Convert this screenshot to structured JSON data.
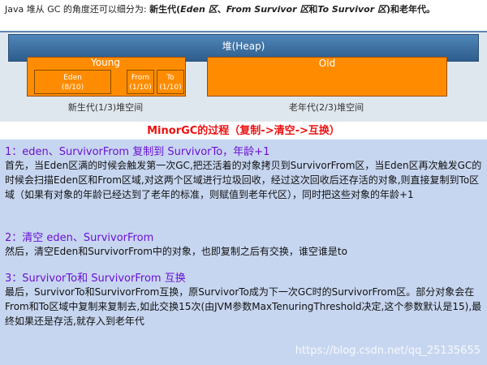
{
  "intro": {
    "prefix": "Java 堆从 GC 的角度还可以细分为: ",
    "new_gen": "新生代",
    "paren_open": "(",
    "eden": "Eden 区",
    "sep1": "、",
    "from": "From Survivor 区",
    "and": "和",
    "to": "To Survivor 区",
    "paren_close": ")",
    "and_old": "和老年代",
    "period": "。"
  },
  "diagram": {
    "heap": "堆(Heap)",
    "young": "Young",
    "old": "Old",
    "eden_name": "Eden",
    "eden_ratio": "(8/10)",
    "from_name": "From",
    "from_ratio": "(1/10)",
    "to_name": "To",
    "to_ratio": "(1/10)",
    "young_caption": "新生代(1/3)堆空间",
    "old_caption": "老年代(2/3)堆空间"
  },
  "title": "MinorGC的过程（复制->清空->互换）",
  "sections": [
    {
      "title": "1：eden、SurvivorFrom 复制到 SurvivorTo，年龄+1",
      "body": "首先，当Eden区满的时候会触发第一次GC,把还活着的对象拷贝到SurvivorFrom区，当Eden区再次触发GC的时候会扫描Eden区和From区域,对这两个区域进行垃圾回收，经过这次回收后还存活的对象,则直接复制到To区域（如果有对象的年龄已经达到了老年的标准，则赋值到老年代区），同时把这些对象的年龄+1"
    },
    {
      "title": "2：清空 eden、SurvivorFrom",
      "body": "然后，清空Eden和SurvivorFrom中的对象，也即复制之后有交换，谁空谁是to"
    },
    {
      "title": "3：SurvivorTo和 SurvivorFrom 互换",
      "body": "最后，SurvivorTo和SurvivorFrom互换，原SurvivorTo成为下一次GC时的SurvivorFrom区。部分对象会在From和To区域中复制来复制去,如此交换15次(由JVM参数MaxTenuringThreshold决定,这个参数默认是15),最终如果还是存活,就存入到老年代"
    }
  ],
  "watermark": "https://blog.csdn.net/qq_25135655"
}
